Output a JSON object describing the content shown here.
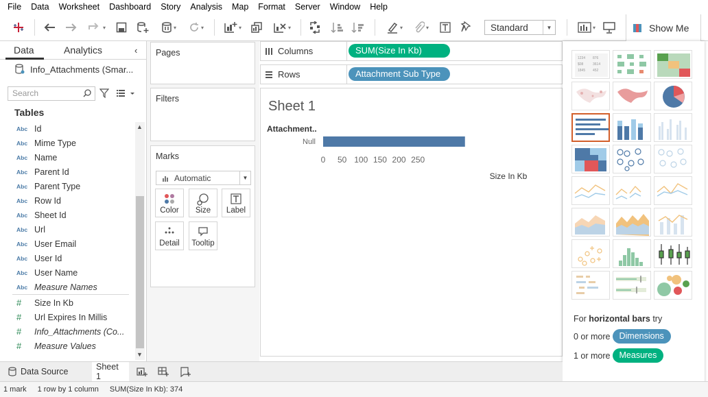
{
  "menu": [
    "File",
    "Data",
    "Worksheet",
    "Dashboard",
    "Story",
    "Analysis",
    "Map",
    "Format",
    "Server",
    "Window",
    "Help"
  ],
  "toolbar": {
    "fit_value": "Standard",
    "show_me_label": "Show Me"
  },
  "data_pane": {
    "tab_data": "Data",
    "tab_analytics": "Analytics",
    "datasource": "Info_Attachments (Smar...",
    "search_placeholder": "Search",
    "tables_heading": "Tables",
    "fields": [
      {
        "type": "Abc",
        "name": "Id",
        "italic": false
      },
      {
        "type": "Abc",
        "name": "Mime Type",
        "italic": false
      },
      {
        "type": "Abc",
        "name": "Name",
        "italic": false
      },
      {
        "type": "Abc",
        "name": "Parent Id",
        "italic": false
      },
      {
        "type": "Abc",
        "name": "Parent Type",
        "italic": false
      },
      {
        "type": "Abc",
        "name": "Row Id",
        "italic": false
      },
      {
        "type": "Abc",
        "name": "Sheet Id",
        "italic": false
      },
      {
        "type": "Abc",
        "name": "Url",
        "italic": false
      },
      {
        "type": "Abc",
        "name": "User Email",
        "italic": false
      },
      {
        "type": "Abc",
        "name": "User Id",
        "italic": false
      },
      {
        "type": "Abc",
        "name": "User Name",
        "italic": false
      },
      {
        "type": "Abc",
        "name": "Measure Names",
        "italic": true
      },
      {
        "type": "#",
        "name": "Size In Kb",
        "italic": false
      },
      {
        "type": "#",
        "name": "Url Expires In Millis",
        "italic": false
      },
      {
        "type": "#",
        "name": "Info_Attachments (Co...",
        "italic": true
      },
      {
        "type": "#",
        "name": "Measure Values",
        "italic": true
      }
    ]
  },
  "cards": {
    "pages": "Pages",
    "filters": "Filters",
    "marks": "Marks",
    "mark_type": "Automatic",
    "mark_buttons": [
      "Color",
      "Size",
      "Label",
      "Detail",
      "Tooltip"
    ]
  },
  "shelves": {
    "columns_label": "Columns",
    "columns_pill": "SUM(Size In Kb)",
    "rows_label": "Rows",
    "rows_pill": "Attachment Sub Type"
  },
  "chart_data": {
    "type": "bar",
    "orientation": "horizontal",
    "title": "Sheet 1",
    "row_header": "Attachment..",
    "categories": [
      "Null"
    ],
    "values": [
      374
    ],
    "xlabel": "Size In Kb",
    "xticks": [
      "0",
      "50",
      "100",
      "150",
      "200",
      "250"
    ],
    "xlim": [
      0,
      260
    ],
    "bar_color": "#4e79a7"
  },
  "show_me": {
    "hint_prefix": "For",
    "hint_chart": "horizontal bars",
    "hint_suffix": "try",
    "dim_prefix": "0 or more",
    "dim_pill": "Dimensions",
    "measure_prefix": "1 or more",
    "measure_pill": "Measures",
    "dim_color": "#4c93bb",
    "measure_color": "#00b180"
  },
  "bottom_tabs": {
    "datasource": "Data Source",
    "sheet": "Sheet 1"
  },
  "status": {
    "marks": "1 mark",
    "layout": "1 row by 1 column",
    "sum": "SUM(Size In Kb): 374"
  }
}
